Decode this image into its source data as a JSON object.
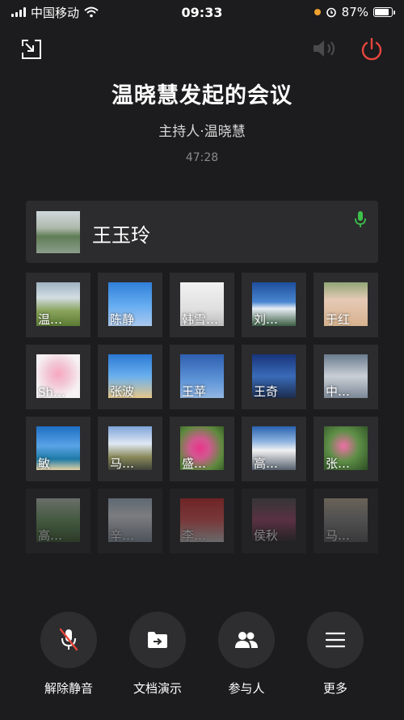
{
  "status_bar": {
    "carrier": "中国移动",
    "time": "09:33",
    "battery": "87%",
    "battery_level": 0.87
  },
  "meeting": {
    "title": "温晓慧发起的会议",
    "host": "主持人·温晓慧",
    "duration": "47:28"
  },
  "speaker": {
    "name": "王玉玲",
    "mic_color": "#3cc04a"
  },
  "participants": [
    {
      "name": "温…"
    },
    {
      "name": "陈静"
    },
    {
      "name": "韩雪…"
    },
    {
      "name": "刘…"
    },
    {
      "name": "于红"
    },
    {
      "name": "Sh…"
    },
    {
      "name": "张波"
    },
    {
      "name": "王苹"
    },
    {
      "name": "王奇"
    },
    {
      "name": "中…"
    },
    {
      "name": "敏"
    },
    {
      "name": "马…"
    },
    {
      "name": "盛…"
    },
    {
      "name": "高…"
    },
    {
      "name": "张…"
    },
    {
      "name": "高…"
    },
    {
      "name": "辛…"
    },
    {
      "name": "李…"
    },
    {
      "name": "侯秋"
    },
    {
      "name": "马…"
    }
  ],
  "toolbar": {
    "unmute": "解除静音",
    "share": "文档演示",
    "participants": "参与人",
    "more": "更多"
  },
  "icons": {
    "minimize": "minimize-window-icon",
    "speaker": "speaker-icon",
    "end": "power-icon",
    "mic_muted": "mic-muted-icon"
  },
  "colors": {
    "end_call": "#e8463c",
    "mic_active": "#3cc04a",
    "mute_slash": "#e8463c"
  }
}
